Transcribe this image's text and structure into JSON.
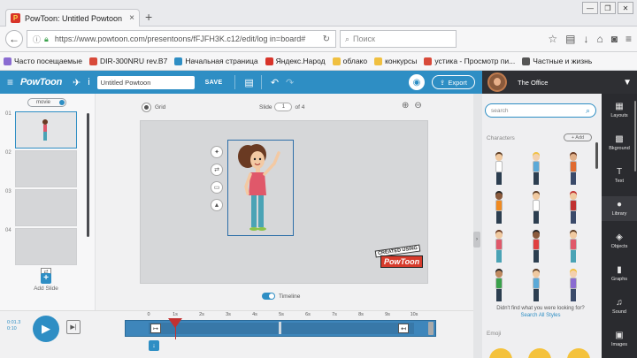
{
  "browser": {
    "tab_title": "PowToon: Untitled Powtoon",
    "tab_close": "×",
    "new_tab": "+",
    "url": "https://www.powtoon.com/presentoons/fFJFH3K.c12/edit/log in=board#",
    "search_placeholder": "Поиск",
    "window": {
      "min": "—",
      "max": "❐",
      "close": "✕"
    }
  },
  "bookmarks": [
    {
      "label": "Часто посещаемые",
      "color": "#8a6bd1"
    },
    {
      "label": "DIR-300NRU rev.B7",
      "color": "#d84a3a"
    },
    {
      "label": "Начальная страница",
      "color": "#2e8ec4"
    },
    {
      "label": "Яндекс.Народ",
      "color": "#d8342a"
    },
    {
      "label": "облако",
      "color": "#f0c040"
    },
    {
      "label": "конкурсы",
      "color": "#f0c040"
    },
    {
      "label": "устика - Просмотр пи...",
      "color": "#d84a3a"
    },
    {
      "label": "Частные и жизнь",
      "color": "#555555"
    }
  ],
  "toolbar": {
    "logo": "PowToon",
    "title_value": "Untitled Powtoon",
    "save_label": "SAVE",
    "export_label": "Export"
  },
  "user": {
    "name": "The Office"
  },
  "slides": {
    "toggle_label": "movie",
    "items": [
      {
        "num": "01",
        "active": true
      },
      {
        "num": "02",
        "active": false
      },
      {
        "num": "03",
        "active": false
      },
      {
        "num": "04",
        "active": false
      }
    ],
    "add_label": "Add Slide"
  },
  "canvas": {
    "grid_label": "Grid",
    "slide_label": "Slide",
    "slide_current": "1",
    "slide_of": "of 4",
    "timeline_label": "Timeline",
    "watermark_top": "CREATED USING",
    "watermark_main": "PowToon"
  },
  "library": {
    "search_placeholder": "search",
    "section_characters": "Characters",
    "add_label": "+ Add",
    "empty_text": "Didn't find what you were looking for?",
    "link_text": "Search All Styles",
    "section_emoji": "Emoji"
  },
  "side_tools": [
    {
      "label": "Layouts",
      "icon": "▦"
    },
    {
      "label": "Bkground",
      "icon": "▩"
    },
    {
      "label": "Text",
      "icon": "T"
    },
    {
      "label": "Library",
      "icon": "●"
    },
    {
      "label": "Objects",
      "icon": "◈"
    },
    {
      "label": "Graphs",
      "icon": "▮"
    },
    {
      "label": "Sound",
      "icon": "♫"
    },
    {
      "label": "Images",
      "icon": "▣"
    }
  ],
  "timeline": {
    "time_readout": "0:01.3",
    "time_total": "0:10",
    "ticks": [
      "0",
      "1s",
      "2s",
      "3s",
      "4s",
      "5s",
      "6s",
      "7s",
      "8s",
      "9s",
      "10s"
    ]
  },
  "characters": [
    {
      "hair": "#5a3a22",
      "skin": "#f0c9a0",
      "shirt": "#ffffff",
      "pants": "#2c3e50"
    },
    {
      "hair": "#f0c040",
      "skin": "#f3d0ae",
      "shirt": "#5aa9d8",
      "pants": "#2c3e50"
    },
    {
      "hair": "#6a3a22",
      "skin": "#e0b08a",
      "shirt": "#e06a30",
      "pants": "#3a4a6a"
    },
    {
      "hair": "#222222",
      "skin": "#8a5a3c",
      "shirt": "#f08a20",
      "pants": "#2c3e50"
    },
    {
      "hair": "#5a3a22",
      "skin": "#f0c9a0",
      "shirt": "#ffffff",
      "pants": "#2c3e50"
    },
    {
      "hair": "#c03030",
      "skin": "#f0c9a0",
      "shirt": "#c03030",
      "pants": "#3a4a6a"
    },
    {
      "hair": "#6a3a22",
      "skin": "#f0c9a0",
      "shirt": "#e0586a",
      "pants": "#4aa3b5"
    },
    {
      "hair": "#222222",
      "skin": "#8a5a3c",
      "shirt": "#e04040",
      "pants": "#2c3e50"
    },
    {
      "hair": "#5a3a22",
      "skin": "#f0c9a0",
      "shirt": "#e0586a",
      "pants": "#4aa3b5"
    },
    {
      "hair": "#222222",
      "skin": "#c08a60",
      "shirt": "#3aa14b",
      "pants": "#2c3e50"
    },
    {
      "hair": "#5a3a22",
      "skin": "#f0c9a0",
      "shirt": "#5aa9d8",
      "pants": "#2c3e50"
    },
    {
      "hair": "#f0c040",
      "skin": "#f3d0ae",
      "shirt": "#8a6bd1",
      "pants": "#3a4a6a"
    }
  ]
}
